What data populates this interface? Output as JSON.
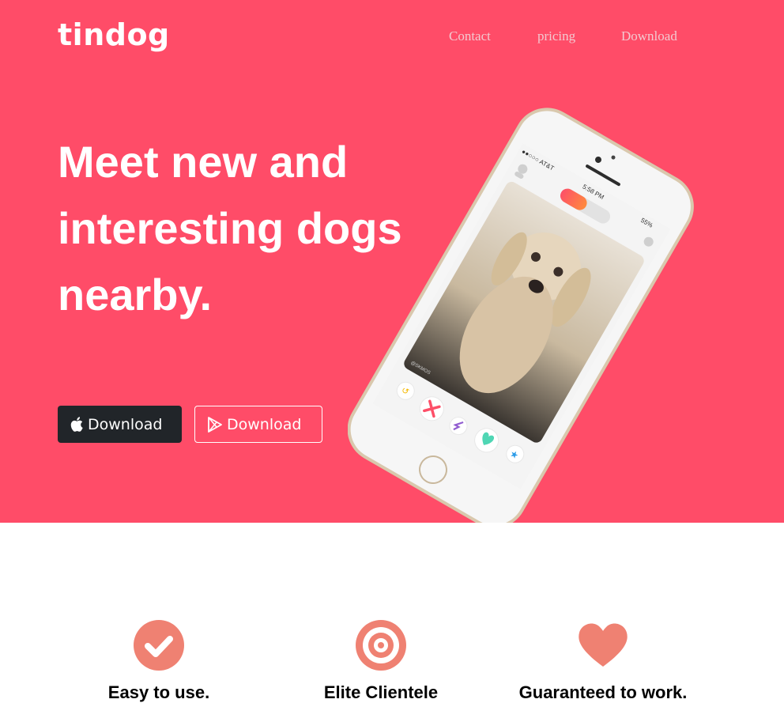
{
  "brand": {
    "name": "tindog"
  },
  "nav": {
    "items": [
      "Contact",
      "pricing",
      "Download"
    ]
  },
  "hero": {
    "headline": "Meet new and interesting dogs nearby.",
    "buttons": {
      "apple_label": "Download",
      "play_label": "Download"
    }
  },
  "phone": {
    "carrier": "●●○○○ AT&T",
    "time": "5:58 PM",
    "battery": "55%",
    "watermark": "@SKMOS"
  },
  "features": [
    {
      "title": "Easy to use.",
      "icon": "check-circle-icon"
    },
    {
      "title": "Elite Clientele",
      "icon": "bullseye-icon"
    },
    {
      "title": "Guaranteed to work.",
      "icon": "heart-icon"
    }
  ],
  "colors": {
    "hero_bg": "#ff4c68",
    "accent_icon": "#ef8172",
    "dark_button": "#212529",
    "nav_link": "#f3c9d0"
  }
}
